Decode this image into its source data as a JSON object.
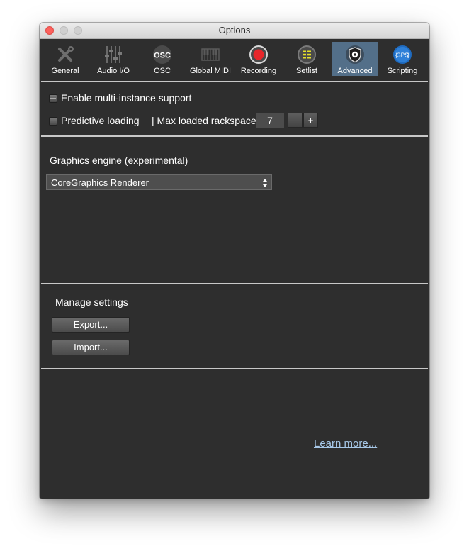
{
  "window": {
    "title": "Options"
  },
  "toolbar": {
    "tabs": [
      {
        "label": "General",
        "icon": "tools-icon"
      },
      {
        "label": "Audio I/O",
        "icon": "mixer-faders-icon"
      },
      {
        "label": "OSC",
        "icon": "osc-icon",
        "icon_text": "OSC"
      },
      {
        "label": "Global MIDI",
        "icon": "midi-keyboard-icon"
      },
      {
        "label": "Recording",
        "icon": "record-icon"
      },
      {
        "label": "Setlist",
        "icon": "setlist-icon"
      },
      {
        "label": "Advanced",
        "icon": "shield-gear-icon",
        "selected": true
      },
      {
        "label": "Scripting",
        "icon": "gps-script-icon",
        "icon_text": "GPS"
      }
    ]
  },
  "advanced": {
    "multi_instance_label": "Enable multi-instance support",
    "predictive_loading_label": "Predictive loading",
    "max_rackspaces_label": "| Max loaded rackspaces",
    "max_rackspaces_value": "7",
    "decrement_label": "–",
    "increment_label": "+",
    "graphics_engine_label": "Graphics engine (experimental)",
    "graphics_engine_value": "CoreGraphics Renderer",
    "manage_settings_label": "Manage settings",
    "export_label": "Export...",
    "import_label": "Import...",
    "learn_more_label": "Learn more..."
  },
  "colors": {
    "window_background": "#2e2e2e",
    "selected_tab": "#536f89",
    "link": "#a7c8e8",
    "close_button": "#fc615d"
  }
}
